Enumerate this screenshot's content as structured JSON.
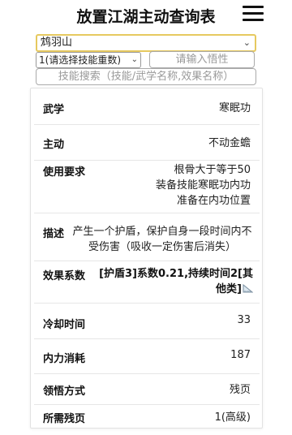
{
  "header": {
    "title": "放置江湖主动查询表"
  },
  "filters": {
    "skill_select_value": "鸩羽山",
    "level_select_value": "1(请选择技能重数)",
    "wuxing_placeholder": "请输入悟性",
    "search_placeholder": "技能搜索（技能/武学名称,效果名称）"
  },
  "details": {
    "wuxue_label": "武学",
    "wuxue_value": "寒眠功",
    "zhudong_label": "主动",
    "zhudong_value": "不动金蟾",
    "req_label": "使用要求",
    "req_lines": [
      "根骨大于等于50",
      "装备技能寒眠功内功",
      "准备在内功位置"
    ],
    "desc_label": "描述",
    "desc_value": "产生一个护盾，保护自身一段时间内不受伤害（吸收一定伤害后消失）",
    "effect_label": "效果系数",
    "effect_value": "[护盾3]系数0.21,持续时间2[其他类]",
    "cooldown_label": "冷却时间",
    "cooldown_value": "33",
    "neili_label": "内力消耗",
    "neili_value": "187",
    "lingwu_label": "领悟方式",
    "lingwu_value": "残页",
    "canye_label": "所需残页",
    "canye_value": "1(高级)"
  }
}
